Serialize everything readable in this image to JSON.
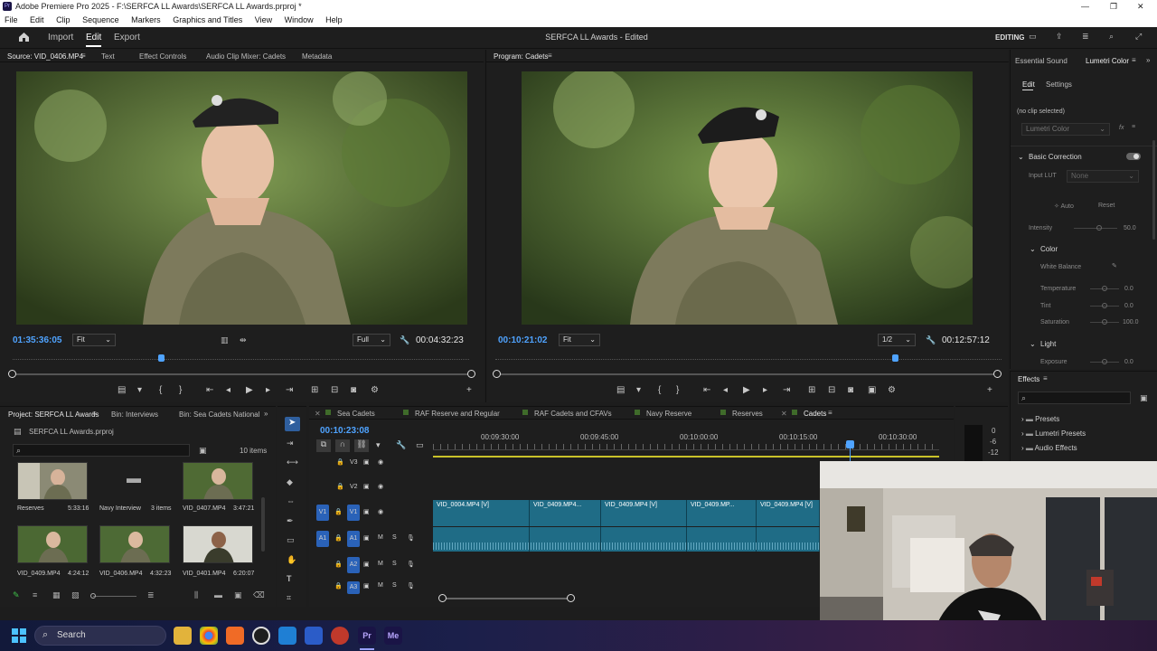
{
  "window": {
    "title": "Adobe Premiere Pro 2025 - F:\\SERFCA LL Awards\\SERFCA LL Awards.prproj *"
  },
  "menu": [
    "File",
    "Edit",
    "Clip",
    "Sequence",
    "Markers",
    "Graphics and Titles",
    "View",
    "Window",
    "Help"
  ],
  "appbar": {
    "tabs": [
      "Import",
      "Edit",
      "Export"
    ],
    "project_title": "SERFCA LL Awards - Edited",
    "workspace": "EDITING"
  },
  "source_panel": {
    "tabs": [
      "Source: VID_0406.MP4",
      "Text",
      "Effect Controls",
      "Audio Clip Mixer: Cadets",
      "Metadata"
    ],
    "timecode": "01:35:36:05",
    "fit": "Fit",
    "quality": "Full",
    "duration": "00:04:32:23"
  },
  "program_panel": {
    "tab": "Program: Cadets",
    "timecode": "00:10:21:02",
    "fit": "Fit",
    "quality": "1/2",
    "duration": "00:12:57:12"
  },
  "right_panel": {
    "tabs": [
      "Essential Sound",
      "Lumetri Color"
    ],
    "subtabs": [
      "Edit",
      "Settings"
    ],
    "no_clip": "(no clip selected)",
    "effect_dd": "Lumetri Color",
    "basic_correction": "Basic Correction",
    "input_lut_label": "Input LUT",
    "input_lut_value": "None",
    "auto": "Auto",
    "reset": "Reset",
    "intensity_label": "Intensity",
    "intensity_value": "50.0",
    "color_section": "Color",
    "white_balance": "White Balance",
    "temperature_label": "Temperature",
    "temperature_value": "0.0",
    "tint_label": "Tint",
    "tint_value": "0.0",
    "saturation_label": "Saturation",
    "saturation_value": "100.0",
    "light_section": "Light",
    "exposure_label": "Exposure",
    "exposure_value": "0.0"
  },
  "effects_panel": {
    "title": "Effects",
    "items": [
      "Presets",
      "Lumetri Presets",
      "Audio Effects"
    ]
  },
  "project_panel": {
    "tabs": [
      "Project: SERFCA LL Awards",
      "Bin: Interviews",
      "Bin: Sea Cadets National Bar"
    ],
    "file": "SERFCA LL Awards.prproj",
    "count": "10 items",
    "items": [
      {
        "name": "Reserves",
        "meta": "5:33:16"
      },
      {
        "name": "Navy Interview",
        "meta": "3 items"
      },
      {
        "name": "VID_0407.MP4",
        "meta": "3:47:21"
      },
      {
        "name": "VID_0409.MP4",
        "meta": "4:24:12"
      },
      {
        "name": "VID_0406.MP4",
        "meta": "4:32:23"
      },
      {
        "name": "VID_0401.MP4",
        "meta": "6:20:07"
      }
    ]
  },
  "timeline": {
    "tabs": [
      "Sea Cadets",
      "RAF Reserve and Regular",
      "RAF Cadets and CFAVs",
      "Navy Reserve",
      "Reserves",
      "Cadets"
    ],
    "timecode": "00:10:23:08",
    "ruler": [
      "00:09:30:00",
      "00:09:45:00",
      "00:10:00:00",
      "00:10:15:00",
      "00:10:30:00"
    ],
    "tracks_video": [
      "V3",
      "V2",
      "V1"
    ],
    "tracks_audio": [
      "A1",
      "A2",
      "A3"
    ],
    "clips": [
      "VID_0004.MP4 [V]",
      "VID_0409.MP4...",
      "VID_0409.MP4 [V]",
      "VID_0409.MP...",
      "VID_0409.MP4 [V]"
    ]
  },
  "meter": {
    "labels": [
      "0",
      "-6",
      "-12"
    ]
  },
  "taskbar": {
    "search": "Search",
    "apps": [
      "Pr",
      "Me"
    ]
  },
  "colors": {
    "accent": "#4fa3ff",
    "clip": "#1f6c86",
    "panel": "#1e1e1e",
    "playhead": "#4fa3ff"
  }
}
